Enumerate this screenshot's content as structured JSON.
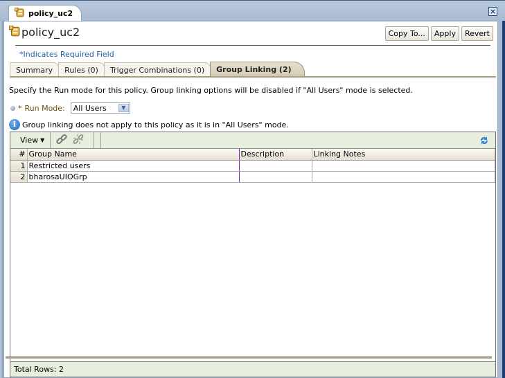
{
  "window": {
    "tab_title": "policy_uc2",
    "close_icon": "close-icon"
  },
  "header": {
    "title": "policy_uc2",
    "icon": "policy-database-icon",
    "buttons": {
      "copy_to": "Copy To...",
      "apply": "Apply",
      "revert": "Revert"
    }
  },
  "required_note": "*Indicates Required Field",
  "tabs": [
    {
      "label": "Summary",
      "active": false
    },
    {
      "label": "Rules (0)",
      "active": false
    },
    {
      "label": "Trigger Combinations (0)",
      "active": false
    },
    {
      "label": "Group Linking (2)",
      "active": true
    }
  ],
  "description": "Specify the Run mode for this policy. Group linking options will be disabled if \"All Users\" mode is selected.",
  "run_mode": {
    "required_marker": "*",
    "label": "Run Mode:",
    "value": "All Users"
  },
  "info_message": "Group linking does not apply to this policy as it is in \"All Users\" mode.",
  "table": {
    "toolbar": {
      "view_label": "View",
      "link_icon": "link-icon",
      "unlink_icon": "unlink-icon",
      "refresh_icon": "refresh-icon"
    },
    "columns": [
      "#",
      "Group Name",
      "Description",
      "Linking Notes"
    ],
    "rows": [
      {
        "num": "1",
        "group_name": "Restricted users",
        "description": "",
        "linking_notes": ""
      },
      {
        "num": "2",
        "group_name": "bharosaUIOGrp",
        "description": "",
        "linking_notes": ""
      }
    ],
    "footer": "Total Rows: 2"
  }
}
